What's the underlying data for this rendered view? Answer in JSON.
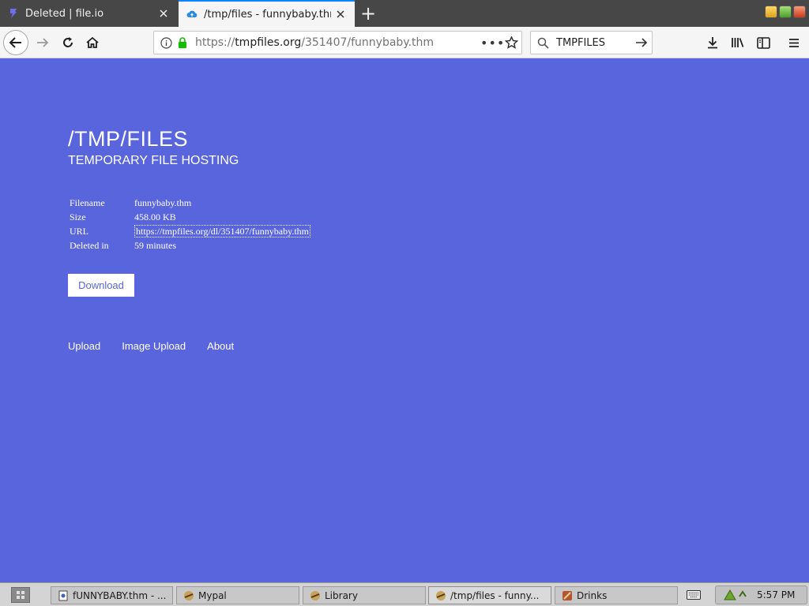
{
  "browser": {
    "tabs": [
      {
        "title": "Deleted | file.io",
        "active": false,
        "icon": "file-io-icon"
      },
      {
        "title": "/tmp/files - funnybaby.thm",
        "active": true,
        "icon": "cloud-upload-icon"
      }
    ],
    "url": {
      "scheme_host_prefix": "https://",
      "host": "tmpfiles.org",
      "path": "/351407/funnybaby.thm"
    },
    "search_value": "TMPFILES",
    "colors": {
      "tabstrip": "#474747",
      "accent": "#0a84ff",
      "lock": "#12bc00"
    }
  },
  "page": {
    "title": "/TMP/FILES",
    "subtitle": "TEMPORARY FILE HOSTING",
    "file_info": {
      "filename_label": "Filename",
      "filename": "funnybaby.thm",
      "size_label": "Size",
      "size": "458.00 KB",
      "url_label": "URL",
      "url": "https://tmpfiles.org/dl/351407/funnybaby.thm",
      "deleted_label": "Deleted in",
      "deleted": "59 minutes"
    },
    "download_label": "Download",
    "footer_links": [
      "Upload",
      "Image Upload",
      "About"
    ],
    "colors": {
      "background": "#5965dc",
      "text": "#ffffff"
    }
  },
  "taskbar": {
    "tasks": [
      {
        "label": "fUNNYBABY.thm - ...",
        "icon": "document-icon"
      },
      {
        "label": "Mypal",
        "icon": "mypal-icon"
      },
      {
        "label": "Library",
        "icon": "mypal-icon"
      },
      {
        "label": "/tmp/files - funny...",
        "icon": "mypal-icon"
      },
      {
        "label": "Drinks",
        "icon": "drinks-icon"
      }
    ],
    "clock": "5:57 PM"
  }
}
